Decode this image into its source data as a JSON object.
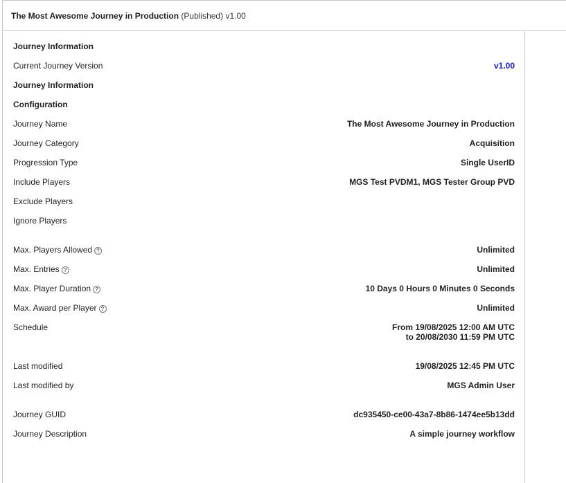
{
  "header": {
    "title": "The Most Awesome Journey in Production",
    "status": "(Published)",
    "version": "v1.00"
  },
  "sections": {
    "journey_info": "Journey Information",
    "journey_info_2": "Journey Information",
    "configuration": "Configuration"
  },
  "version_row": {
    "label": "Current Journey Version",
    "value": "v1.00"
  },
  "config": {
    "journey_name": {
      "label": "Journey Name",
      "value": "The Most Awesome Journey in Production"
    },
    "journey_category": {
      "label": "Journey Category",
      "value": "Acquisition"
    },
    "progression_type": {
      "label": "Progression Type",
      "value": "Single UserID"
    },
    "include_players": {
      "label": "Include Players",
      "value": "MGS Test PVDM1, MGS Tester Group PVD"
    },
    "exclude_players": {
      "label": "Exclude Players",
      "value": ""
    },
    "ignore_players": {
      "label": "Ignore Players",
      "value": ""
    }
  },
  "limits": {
    "max_players": {
      "label": "Max. Players Allowed",
      "value": "Unlimited"
    },
    "max_entries": {
      "label": "Max. Entries",
      "value": "Unlimited"
    },
    "max_duration": {
      "label": "Max. Player Duration",
      "value": "10 Days 0 Hours 0 Minutes 0 Seconds"
    },
    "max_award": {
      "label": "Max. Award per Player",
      "value": "Unlimited"
    },
    "schedule": {
      "label": "Schedule",
      "from": "From 19/08/2025 12:00 AM UTC",
      "to": "to 20/08/2030 11:59 PM UTC"
    }
  },
  "audit": {
    "last_modified": {
      "label": "Last modified",
      "value": "19/08/2025 12:45 PM UTC"
    },
    "last_modified_by": {
      "label": "Last modified by",
      "value": "MGS Admin User"
    }
  },
  "meta": {
    "guid": {
      "label": "Journey GUID",
      "value": "dc935450-ce00-43a7-8b86-1474ee5b13dd"
    },
    "description": {
      "label": "Journey Description",
      "value": "A simple journey workflow"
    }
  },
  "icons": {
    "help": "help-circle-icon",
    "help_glyph": "?"
  },
  "colors": {
    "accent": "#1a1ad6",
    "border": "#c8c8c8"
  }
}
